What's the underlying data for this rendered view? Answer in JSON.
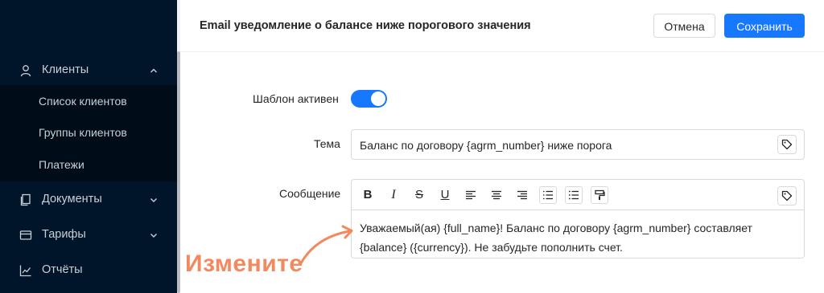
{
  "sidebar": {
    "items": [
      {
        "label": "Клиенты",
        "icon": "user-icon",
        "expanded": true
      },
      {
        "label": "Документы",
        "icon": "documents-icon",
        "expanded": false
      },
      {
        "label": "Тарифы",
        "icon": "card-icon",
        "expanded": false
      },
      {
        "label": "Отчёты",
        "icon": "chart-icon",
        "expanded": false
      }
    ],
    "submenu": [
      "Список клиентов",
      "Группы клиентов",
      "Платежи"
    ]
  },
  "header": {
    "title": "Email уведомление о балансе ниже порогового значения",
    "cancel_label": "Отмена",
    "save_label": "Сохранить"
  },
  "form": {
    "active_label": "Шаблон активен",
    "active": true,
    "subject_label": "Тема",
    "subject_value": "Баланс по договору {agrm_number} ниже порога",
    "message_label": "Сообщение",
    "message_value": "Уважаемый(ая) {full_name}! Баланс по договору {agrm_number} составляет {balance} ({currency}). Не забудьте пополнить счет.",
    "toolbar": {
      "bold": "B",
      "italic": "I",
      "strike": "S",
      "underline": "U"
    }
  },
  "annotation": {
    "text": "Измените"
  },
  "colors": {
    "sidebar_bg": "#001529",
    "submenu_bg": "#000c17",
    "primary": "#1677ff",
    "annotation": "#f4895f"
  }
}
